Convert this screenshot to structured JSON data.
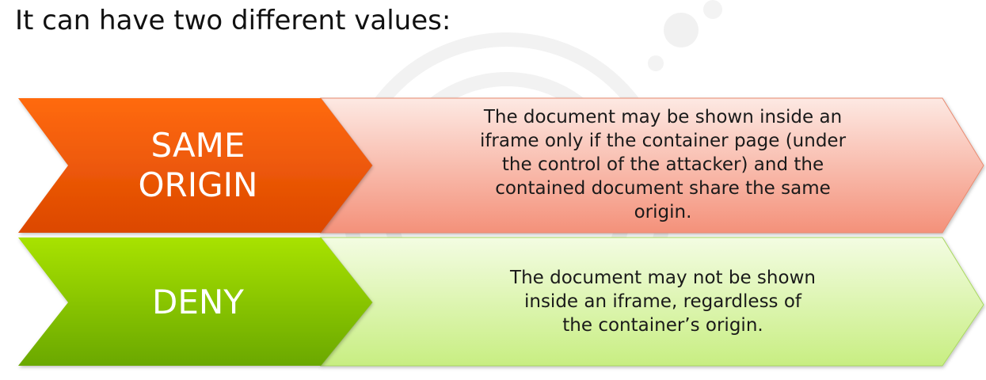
{
  "slide": {
    "heading": "It can have two different values:"
  },
  "colors": {
    "orange_dark": "#e04a00",
    "orange_light": "#ff6a10",
    "salmon_dark": "#f4957a",
    "salmon_light": "#fde6df",
    "green_dark": "#6fb000",
    "green_light": "#a6e000",
    "lime_dark": "#cdf08a",
    "lime_light": "#f1fbdc"
  },
  "options": [
    {
      "keyword": "SAME\nORIGIN",
      "description": "The document may be shown inside an iframe only if the container page (under the control of the attacker) and the contained document share the same origin."
    },
    {
      "keyword": "DENY",
      "description": "The document may not be shown inside an iframe, regardless of the container’s origin."
    }
  ]
}
